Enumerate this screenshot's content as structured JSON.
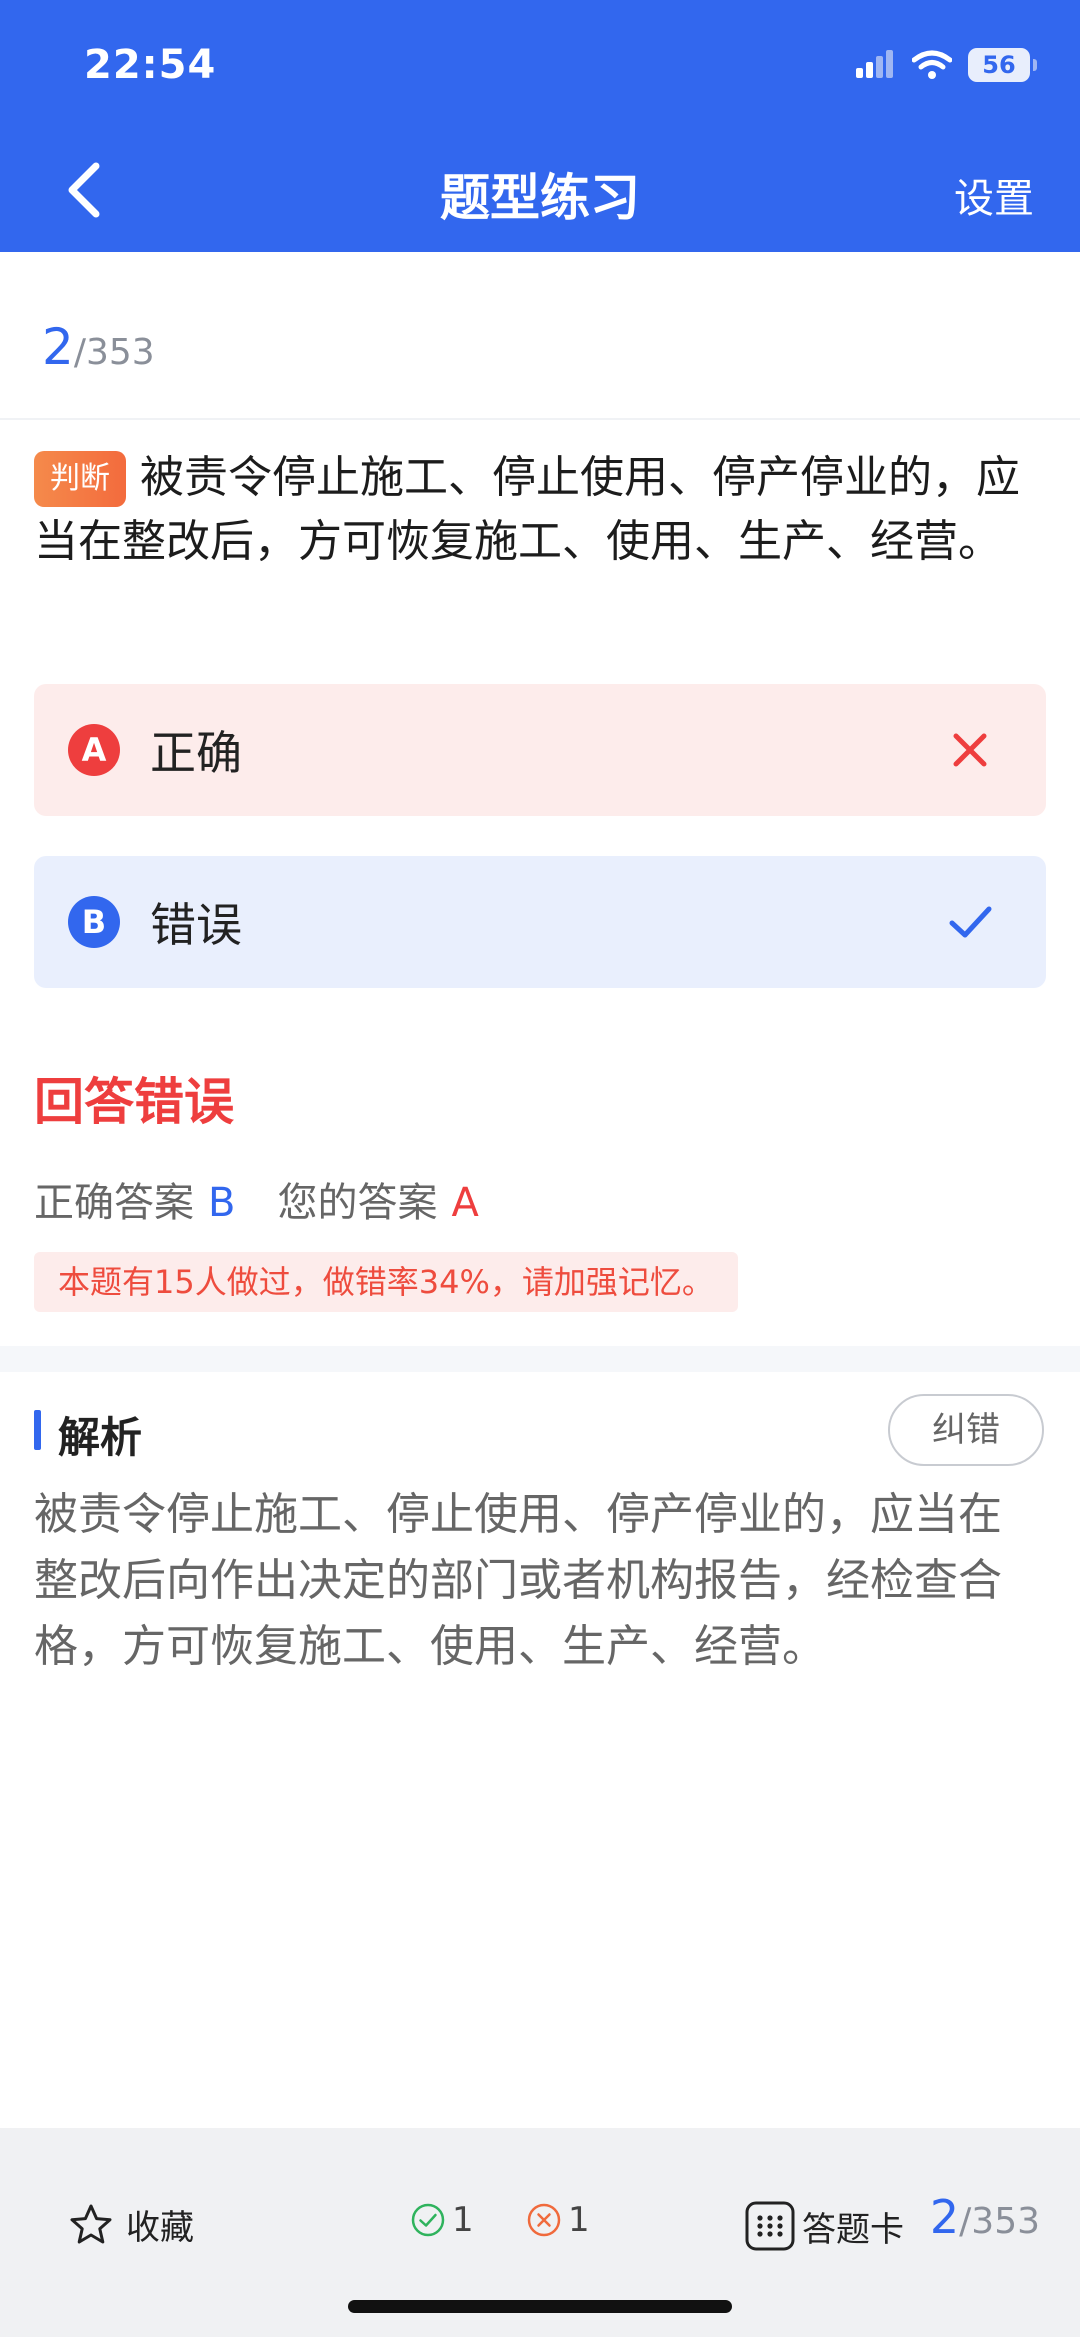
{
  "status_bar": {
    "time": "22:54",
    "battery": "56"
  },
  "nav": {
    "title": "题型练习",
    "settings": "设置"
  },
  "progress": {
    "current": "2",
    "total": "/353"
  },
  "question": {
    "type_tag": "判断",
    "text": "被责令停止施工、停止使用、停产停业的，应当在整改后，方可恢复施工、使用、生产、经营。"
  },
  "options": [
    {
      "letter": "A",
      "text": "正确",
      "state": "wrong"
    },
    {
      "letter": "B",
      "text": "错误",
      "state": "correct"
    }
  ],
  "result": {
    "title": "回答错误",
    "correct_label": "正确答案",
    "correct_value": "B",
    "user_label": "您的答案",
    "user_value": "A",
    "stats_note": "本题有15人做过，做错率34%，请加强记忆。"
  },
  "analysis": {
    "title": "解析",
    "report_button": "纠错",
    "text": "被责令停止施工、停止使用、停产停业的，应当在整改后向作出决定的部门或者机构报告，经检查合格，方可恢复施工、使用、生产、经营。"
  },
  "bottom_bar": {
    "favorite": "收藏",
    "right_count": "1",
    "wrong_count": "1",
    "answer_card": "答题卡",
    "progress_current": "2",
    "progress_total": "/353"
  },
  "colors": {
    "primary": "#3267ee",
    "error": "#ee3e3e",
    "tag": "#f36b3d",
    "correct_icon": "#2fb35d"
  }
}
